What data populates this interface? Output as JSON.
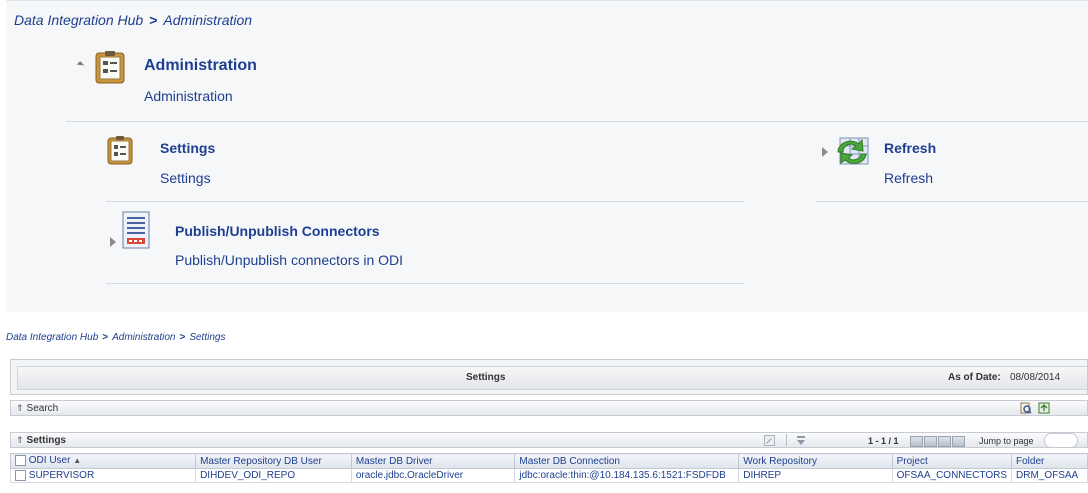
{
  "breadcrumb_top": {
    "root": "Data Integration Hub",
    "sep": ">",
    "current": "Administration"
  },
  "admin": {
    "title": "Administration",
    "description": "Administration"
  },
  "items": {
    "settings": {
      "title": "Settings",
      "description": "Settings"
    },
    "refresh": {
      "title": "Refresh",
      "description": "Refresh"
    },
    "publish": {
      "title": "Publish/Unpublish Connectors",
      "description": "Publish/Unpublish connectors in ODI"
    }
  },
  "breadcrumb_bottom": {
    "root": "Data Integration Hub",
    "sep1": ">",
    "middle": "Administration",
    "sep2": ">",
    "current": "Settings"
  },
  "settings_panel": {
    "title": "Settings",
    "as_of_label": "As of Date:",
    "as_of_value": "08/08/2014"
  },
  "search": {
    "label": "Search"
  },
  "grid": {
    "label": "Settings",
    "pager": {
      "range": "1 - 1 / 1",
      "jump_label": "Jump to page"
    },
    "columns": [
      "ODI User",
      "Master Repository DB User",
      "Master DB Driver",
      "Master DB Connection",
      "Work Repository",
      "Project",
      "Folder"
    ],
    "sort_indicator": "▲",
    "rows": [
      [
        "SUPERVISOR",
        "DIHDEV_ODI_REPO",
        "oracle.jdbc.OracleDriver",
        "jdbc:oracle:thin:@10.184.135.6:1521:FSDFDB",
        "DIHREP",
        "OFSAA_CONNECTORS",
        "DRM_OFSAA"
      ]
    ]
  },
  "icons": {
    "admin": "clipboard-icon",
    "settings": "clipboard-icon",
    "refresh": "refresh-table-icon",
    "publish": "document-list-icon"
  },
  "colors": {
    "link_blue": "#1e3f8f",
    "icon_gold": "#c8953c",
    "icon_green": "#4aa83a"
  }
}
